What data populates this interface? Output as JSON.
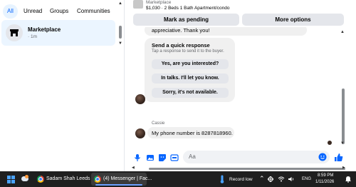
{
  "filters": [
    {
      "label": "All",
      "active": true
    },
    {
      "label": "Unread",
      "active": false
    },
    {
      "label": "Groups",
      "active": false
    },
    {
      "label": "Communities",
      "active": false
    }
  ],
  "conversation": {
    "name": "Marketplace",
    "meta": "· 1m",
    "icon": "store-icon"
  },
  "listing": {
    "category": "Marketplace",
    "title": "$1,030 · 2 Beds 1 Bath Apartment/condo"
  },
  "actions": {
    "pending": "Mark as pending",
    "more": "More options"
  },
  "messages": {
    "appreciation": "appreciative. Thank you!",
    "quick_title": "Send a quick response",
    "quick_sub": "Tap a response to send it to the buyer.",
    "quick_replies": [
      "Yes, are you interested?",
      "In talks. I'll let you know.",
      "Sorry, it's not available."
    ],
    "sender": "Cassie",
    "phone_msg": "My phone number is 8287818960."
  },
  "composer": {
    "placeholder": "Aa",
    "icons": [
      "microphone-icon",
      "image-icon",
      "sticker-icon",
      "gif-icon",
      "emoji-icon",
      "like-thumb-icon"
    ]
  },
  "taskbar": {
    "apps": [
      {
        "label": "Sadam Shah Leeds ...",
        "active": false
      },
      {
        "label": "(4) Messenger | Fac...",
        "active": true
      }
    ],
    "record": "Record low",
    "lang": "ENG",
    "time": "8:59 PM",
    "date": "1/11/2026"
  },
  "colors": {
    "accent": "#0866ff",
    "active_conv": "#ebf5ff",
    "taskbar": "#1f1f1f"
  }
}
